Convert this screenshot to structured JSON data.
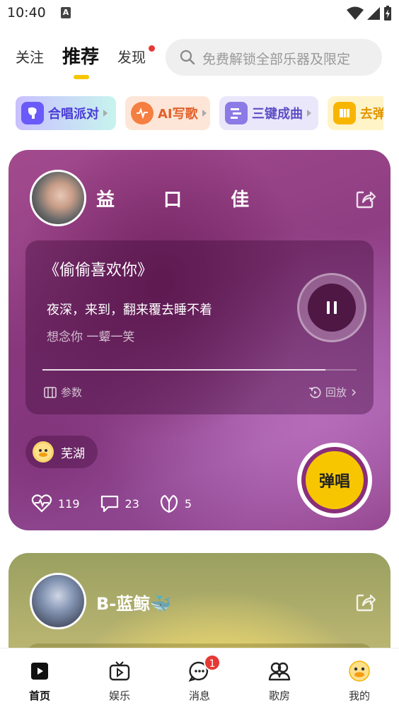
{
  "status_bar": {
    "time": "10:40",
    "notification_icon": "A"
  },
  "top_nav": {
    "tabs": [
      {
        "label": "关注"
      },
      {
        "label": "推荐",
        "active": true
      },
      {
        "label": "发现",
        "has_dot": true
      }
    ],
    "search_placeholder": "免费解锁全部乐器及限定"
  },
  "chips": [
    {
      "label": "合唱派对",
      "icon": "mic-icon"
    },
    {
      "label": "AI写歌",
      "icon": "ai-write-icon"
    },
    {
      "label": "三键成曲",
      "icon": "compose-icon"
    },
    {
      "label": "去弹",
      "icon": "book-icon"
    }
  ],
  "feed": {
    "card1": {
      "user_name": "益 口 佳",
      "song_title": "《偷偷喜欢你》",
      "lyric_line_1": "夜深，来到，翻来覆去睡不着",
      "lyric_line_2": "想念你 一颦一笑",
      "progress": 0.9,
      "params_label": "参数",
      "replay_label": "回放",
      "location": "芜湖",
      "sing_label": "弹唱",
      "likes": "119",
      "comments": "23",
      "gifts": "5",
      "colors": {
        "accent": "#f7c600",
        "card": "#9b4890"
      }
    },
    "card2": {
      "user_name": "B-蓝鲸🐳"
    }
  },
  "bottom_nav": {
    "items": [
      {
        "label": "首页",
        "active": true
      },
      {
        "label": "娱乐"
      },
      {
        "label": "消息",
        "badge": "1"
      },
      {
        "label": "歌房"
      },
      {
        "label": "我的"
      }
    ]
  }
}
